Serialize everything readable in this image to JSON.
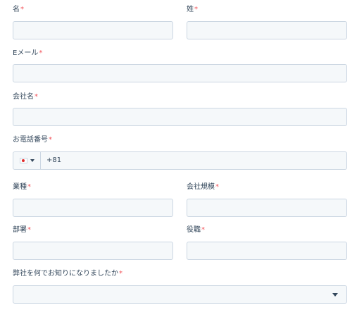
{
  "required_marker": "*",
  "fields": {
    "first_name": {
      "label": "名",
      "value": ""
    },
    "last_name": {
      "label": "姓",
      "value": ""
    },
    "email": {
      "label": "Eメール",
      "value": ""
    },
    "company": {
      "label": "会社名",
      "value": ""
    },
    "phone": {
      "label": "お電話番号",
      "country": "JP",
      "dial_code": "+81",
      "value": ""
    },
    "industry": {
      "label": "業種",
      "value": ""
    },
    "company_size": {
      "label": "会社規模",
      "value": ""
    },
    "department": {
      "label": "部署",
      "value": ""
    },
    "job_title": {
      "label": "役職",
      "value": ""
    },
    "referral_source": {
      "label": "弊社を何でお知りになりましたか",
      "value": ""
    }
  },
  "colors": {
    "label_text": "#33475b",
    "required_marker": "#f2545b",
    "input_border": "#cbd6e2",
    "input_background": "#f5f8fa"
  },
  "icons": {
    "country_flag": "japan-flag-icon",
    "country_dropdown": "caret-down-icon",
    "select_dropdown": "caret-down-icon"
  }
}
